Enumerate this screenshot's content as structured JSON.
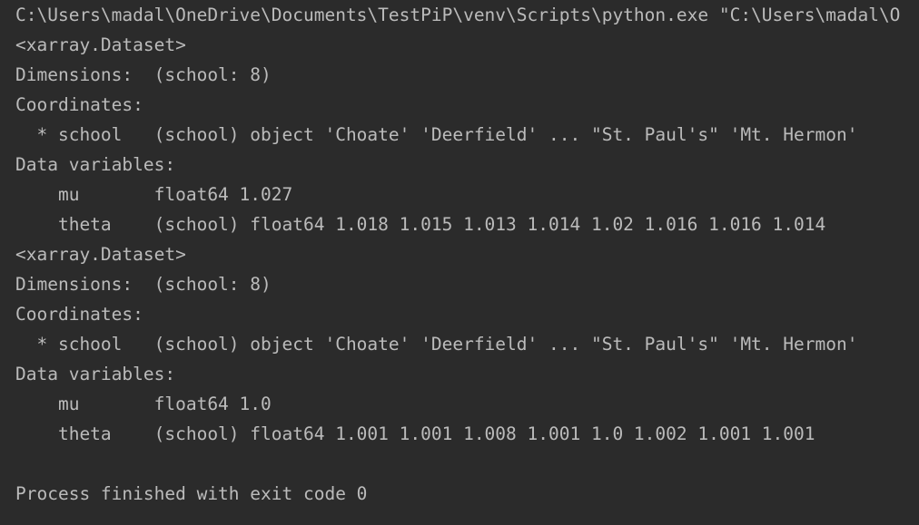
{
  "console": {
    "lines": [
      "C:\\Users\\madal\\OneDrive\\Documents\\TestPiP\\venv\\Scripts\\python.exe \"C:\\Users\\madal\\O",
      "<xarray.Dataset>",
      "Dimensions:  (school: 8)",
      "Coordinates:",
      "  * school   (school) object 'Choate' 'Deerfield' ... \"St. Paul's\" 'Mt. Hermon'",
      "Data variables:",
      "    mu       float64 1.027",
      "    theta    (school) float64 1.018 1.015 1.013 1.014 1.02 1.016 1.016 1.014",
      "<xarray.Dataset>",
      "Dimensions:  (school: 8)",
      "Coordinates:",
      "  * school   (school) object 'Choate' 'Deerfield' ... \"St. Paul's\" 'Mt. Hermon'",
      "Data variables:",
      "    mu       float64 1.0",
      "    theta    (school) float64 1.001 1.001 1.008 1.001 1.0 1.002 1.001 1.001",
      "",
      "Process finished with exit code 0"
    ]
  }
}
